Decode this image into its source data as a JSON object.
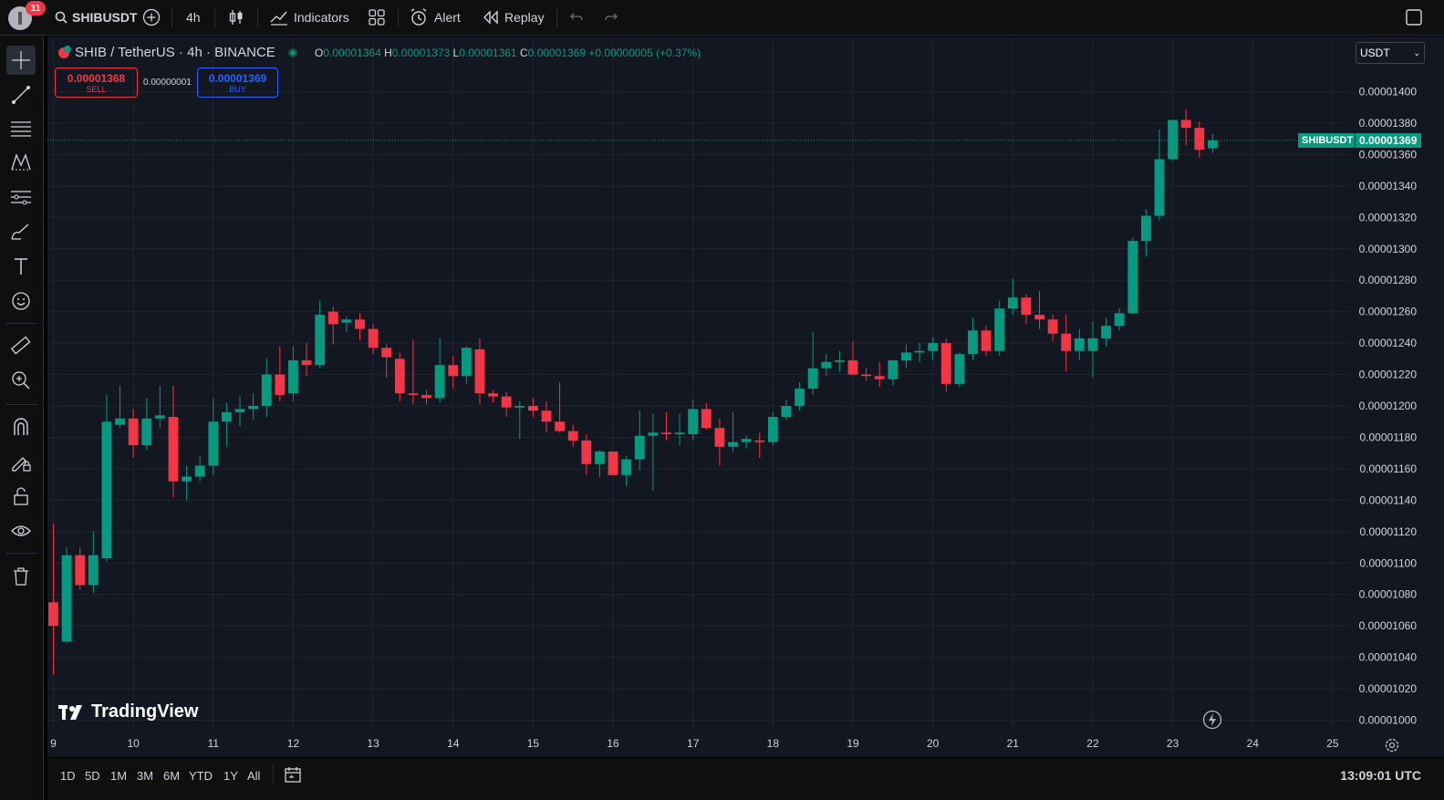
{
  "topbar": {
    "notification_count": "11",
    "symbol": "SHIBUSDT",
    "interval": "4h",
    "indicators_label": "Indicators",
    "alert_label": "Alert",
    "replay_label": "Replay"
  },
  "legend": {
    "title": "SHIB / TetherUS · 4h · BINANCE",
    "open_label": "O",
    "open": "0.00001364",
    "high_label": "H",
    "high": "0.00001373",
    "low_label": "L",
    "low": "0.00001361",
    "close_label": "C",
    "close": "0.00001369",
    "change": "+0.00000005 (+0.37%)"
  },
  "trade": {
    "sell_price": "0.00001368",
    "sell_label": "SELL",
    "spread": "0.00000001",
    "buy_price": "0.00001369",
    "buy_label": "BUY"
  },
  "currency_select": "USDT",
  "price_tag": {
    "symbol": "SHIBUSDT",
    "price": "0.00001369"
  },
  "watermark": "TradingView",
  "bottombar": {
    "ranges": [
      "1D",
      "5D",
      "1M",
      "3M",
      "6M",
      "YTD",
      "1Y",
      "All"
    ],
    "clock": "13:09:01 UTC"
  },
  "colors": {
    "up": "#089981",
    "down": "#f23645",
    "background": "#131722",
    "grid": "#1f2330"
  },
  "icons": {
    "topbar": [
      "avatar-icon",
      "search-icon",
      "add-symbol-icon",
      "candles-icon",
      "indicators-icon",
      "layouts-icon",
      "alert-icon",
      "replay-icon",
      "undo-icon",
      "redo-icon",
      "fullscreen-icon"
    ],
    "leftbar": [
      "crosshair-icon",
      "trendline-icon",
      "fib-icon",
      "pattern-icon",
      "forecast-icon",
      "brush-icon",
      "text-icon",
      "emoji-icon",
      "ruler-icon",
      "zoom-in-icon",
      "magnet-icon",
      "lock-draw-icon",
      "lock-icon",
      "eye-icon",
      "trash-icon"
    ]
  },
  "chart_data": {
    "type": "candlestick",
    "symbol": "SHIBUSDT",
    "interval": "4h",
    "ylim": [
      1e-05,
      1.41e-05
    ],
    "y_ticks": [
      "0.00001400",
      "0.00001380",
      "0.00001360",
      "0.00001340",
      "0.00001320",
      "0.00001300",
      "0.00001280",
      "0.00001260",
      "0.00001240",
      "0.00001220",
      "0.00001200",
      "0.00001180",
      "0.00001160",
      "0.00001140",
      "0.00001120",
      "0.00001100",
      "0.00001080",
      "0.00001060",
      "0.00001040",
      "0.00001020",
      "0.00001000"
    ],
    "x_ticks": [
      "9",
      "10",
      "11",
      "12",
      "13",
      "14",
      "15",
      "16",
      "17",
      "18",
      "19",
      "20",
      "21",
      "22",
      "23",
      "24",
      "25"
    ],
    "last_price": 1.369e-05,
    "candles": [
      {
        "o": 1.075e-05,
        "h": 1.125e-05,
        "l": 1.029e-05,
        "c": 1.06e-05
      },
      {
        "o": 1.05e-05,
        "h": 1.11e-05,
        "l": 1.049e-05,
        "c": 1.105e-05
      },
      {
        "o": 1.105e-05,
        "h": 1.11e-05,
        "l": 1.083e-05,
        "c": 1.086e-05
      },
      {
        "o": 1.086e-05,
        "h": 1.12e-05,
        "l": 1.081e-05,
        "c": 1.105e-05
      },
      {
        "o": 1.103e-05,
        "h": 1.207e-05,
        "l": 1.101e-05,
        "c": 1.19e-05
      },
      {
        "o": 1.188e-05,
        "h": 1.213e-05,
        "l": 1.186e-05,
        "c": 1.192e-05
      },
      {
        "o": 1.192e-05,
        "h": 1.198e-05,
        "l": 1.167e-05,
        "c": 1.175e-05
      },
      {
        "o": 1.175e-05,
        "h": 1.205e-05,
        "l": 1.172e-05,
        "c": 1.192e-05
      },
      {
        "o": 1.192e-05,
        "h": 1.213e-05,
        "l": 1.186e-05,
        "c": 1.194e-05
      },
      {
        "o": 1.193e-05,
        "h": 1.213e-05,
        "l": 1.142e-05,
        "c": 1.152e-05
      },
      {
        "o": 1.152e-05,
        "h": 1.162e-05,
        "l": 1.14e-05,
        "c": 1.155e-05
      },
      {
        "o": 1.155e-05,
        "h": 1.168e-05,
        "l": 1.152e-05,
        "c": 1.162e-05
      },
      {
        "o": 1.162e-05,
        "h": 1.205e-05,
        "l": 1.156e-05,
        "c": 1.19e-05
      },
      {
        "o": 1.19e-05,
        "h": 1.202e-05,
        "l": 1.174e-05,
        "c": 1.196e-05
      },
      {
        "o": 1.196e-05,
        "h": 1.206e-05,
        "l": 1.187e-05,
        "c": 1.198e-05
      },
      {
        "o": 1.198e-05,
        "h": 1.208e-05,
        "l": 1.191e-05,
        "c": 1.2e-05
      },
      {
        "o": 1.2e-05,
        "h": 1.23e-05,
        "l": 1.193e-05,
        "c": 1.22e-05
      },
      {
        "o": 1.22e-05,
        "h": 1.238e-05,
        "l": 1.203e-05,
        "c": 1.207e-05
      },
      {
        "o": 1.208e-05,
        "h": 1.238e-05,
        "l": 1.203e-05,
        "c": 1.229e-05
      },
      {
        "o": 1.229e-05,
        "h": 1.24e-05,
        "l": 1.219e-05,
        "c": 1.226e-05
      },
      {
        "o": 1.226e-05,
        "h": 1.267e-05,
        "l": 1.224e-05,
        "c": 1.258e-05
      },
      {
        "o": 1.26e-05,
        "h": 1.263e-05,
        "l": 1.239e-05,
        "c": 1.252e-05
      },
      {
        "o": 1.253e-05,
        "h": 1.257e-05,
        "l": 1.247e-05,
        "c": 1.255e-05
      },
      {
        "o": 1.255e-05,
        "h": 1.259e-05,
        "l": 1.242e-05,
        "c": 1.249e-05
      },
      {
        "o": 1.249e-05,
        "h": 1.252e-05,
        "l": 1.233e-05,
        "c": 1.237e-05
      },
      {
        "o": 1.237e-05,
        "h": 1.239e-05,
        "l": 1.218e-05,
        "c": 1.231e-05
      },
      {
        "o": 1.23e-05,
        "h": 1.234e-05,
        "l": 1.203e-05,
        "c": 1.208e-05
      },
      {
        "o": 1.208e-05,
        "h": 1.242e-05,
        "l": 1.201e-05,
        "c": 1.207e-05
      },
      {
        "o": 1.207e-05,
        "h": 1.21e-05,
        "l": 1.201e-05,
        "c": 1.205e-05
      },
      {
        "o": 1.205e-05,
        "h": 1.243e-05,
        "l": 1.202e-05,
        "c": 1.226e-05
      },
      {
        "o": 1.226e-05,
        "h": 1.232e-05,
        "l": 1.211e-05,
        "c": 1.219e-05
      },
      {
        "o": 1.219e-05,
        "h": 1.238e-05,
        "l": 1.214e-05,
        "c": 1.237e-05
      },
      {
        "o": 1.236e-05,
        "h": 1.243e-05,
        "l": 1.201e-05,
        "c": 1.208e-05
      },
      {
        "o": 1.208e-05,
        "h": 1.21e-05,
        "l": 1.202e-05,
        "c": 1.206e-05
      },
      {
        "o": 1.206e-05,
        "h": 1.209e-05,
        "l": 1.193e-05,
        "c": 1.199e-05
      },
      {
        "o": 1.199e-05,
        "h": 1.203e-05,
        "l": 1.179e-05,
        "c": 1.2e-05
      },
      {
        "o": 1.2e-05,
        "h": 1.205e-05,
        "l": 1.193e-05,
        "c": 1.197e-05
      },
      {
        "o": 1.197e-05,
        "h": 1.203e-05,
        "l": 1.183e-05,
        "c": 1.19e-05
      },
      {
        "o": 1.19e-05,
        "h": 1.215e-05,
        "l": 1.183e-05,
        "c": 1.184e-05
      },
      {
        "o": 1.184e-05,
        "h": 1.188e-05,
        "l": 1.174e-05,
        "c": 1.178e-05
      },
      {
        "o": 1.178e-05,
        "h": 1.182e-05,
        "l": 1.156e-05,
        "c": 1.163e-05
      },
      {
        "o": 1.163e-05,
        "h": 1.172e-05,
        "l": 1.155e-05,
        "c": 1.171e-05
      },
      {
        "o": 1.171e-05,
        "h": 1.171e-05,
        "l": 1.158e-05,
        "c": 1.156e-05
      },
      {
        "o": 1.156e-05,
        "h": 1.168e-05,
        "l": 1.149e-05,
        "c": 1.166e-05
      },
      {
        "o": 1.166e-05,
        "h": 1.197e-05,
        "l": 1.159e-05,
        "c": 1.181e-05
      },
      {
        "o": 1.181e-05,
        "h": 1.195e-05,
        "l": 1.146e-05,
        "c": 1.183e-05
      },
      {
        "o": 1.183e-05,
        "h": 1.196e-05,
        "l": 1.178e-05,
        "c": 1.182e-05
      },
      {
        "o": 1.182e-05,
        "h": 1.195e-05,
        "l": 1.175e-05,
        "c": 1.183e-05
      },
      {
        "o": 1.182e-05,
        "h": 1.204e-05,
        "l": 1.178e-05,
        "c": 1.198e-05
      },
      {
        "o": 1.198e-05,
        "h": 1.202e-05,
        "l": 1.185e-05,
        "c": 1.186e-05
      },
      {
        "o": 1.186e-05,
        "h": 1.192e-05,
        "l": 1.162e-05,
        "c": 1.174e-05
      },
      {
        "o": 1.174e-05,
        "h": 1.196e-05,
        "l": 1.171e-05,
        "c": 1.177e-05
      },
      {
        "o": 1.177e-05,
        "h": 1.181e-05,
        "l": 1.173e-05,
        "c": 1.179e-05
      },
      {
        "o": 1.178e-05,
        "h": 1.183e-05,
        "l": 1.167e-05,
        "c": 1.177e-05
      },
      {
        "o": 1.177e-05,
        "h": 1.196e-05,
        "l": 1.175e-05,
        "c": 1.193e-05
      },
      {
        "o": 1.193e-05,
        "h": 1.204e-05,
        "l": 1.191e-05,
        "c": 1.2e-05
      },
      {
        "o": 1.2e-05,
        "h": 1.215e-05,
        "l": 1.197e-05,
        "c": 1.211e-05
      },
      {
        "o": 1.211e-05,
        "h": 1.247e-05,
        "l": 1.207e-05,
        "c": 1.224e-05
      },
      {
        "o": 1.224e-05,
        "h": 1.233e-05,
        "l": 1.219e-05,
        "c": 1.228e-05
      },
      {
        "o": 1.228e-05,
        "h": 1.235e-05,
        "l": 1.222e-05,
        "c": 1.229e-05
      },
      {
        "o": 1.229e-05,
        "h": 1.241e-05,
        "l": 1.221e-05,
        "c": 1.22e-05
      },
      {
        "o": 1.22e-05,
        "h": 1.224e-05,
        "l": 1.216e-05,
        "c": 1.219e-05
      },
      {
        "o": 1.219e-05,
        "h": 1.228e-05,
        "l": 1.212e-05,
        "c": 1.217e-05
      },
      {
        "o": 1.217e-05,
        "h": 1.229e-05,
        "l": 1.213e-05,
        "c": 1.229e-05
      },
      {
        "o": 1.229e-05,
        "h": 1.239e-05,
        "l": 1.224e-05,
        "c": 1.234e-05
      },
      {
        "o": 1.234e-05,
        "h": 1.24e-05,
        "l": 1.228e-05,
        "c": 1.235e-05
      },
      {
        "o": 1.235e-05,
        "h": 1.244e-05,
        "l": 1.229e-05,
        "c": 1.24e-05
      },
      {
        "o": 1.24e-05,
        "h": 1.243e-05,
        "l": 1.209e-05,
        "c": 1.214e-05
      },
      {
        "o": 1.214e-05,
        "h": 1.234e-05,
        "l": 1.212e-05,
        "c": 1.233e-05
      },
      {
        "o": 1.233e-05,
        "h": 1.256e-05,
        "l": 1.229e-05,
        "c": 1.248e-05
      },
      {
        "o": 1.248e-05,
        "h": 1.251e-05,
        "l": 1.232e-05,
        "c": 1.235e-05
      },
      {
        "o": 1.235e-05,
        "h": 1.267e-05,
        "l": 1.232e-05,
        "c": 1.262e-05
      },
      {
        "o": 1.262e-05,
        "h": 1.281e-05,
        "l": 1.258e-05,
        "c": 1.269e-05
      },
      {
        "o": 1.269e-05,
        "h": 1.271e-05,
        "l": 1.252e-05,
        "c": 1.258e-05
      },
      {
        "o": 1.258e-05,
        "h": 1.273e-05,
        "l": 1.249e-05,
        "c": 1.255e-05
      },
      {
        "o": 1.255e-05,
        "h": 1.258e-05,
        "l": 1.241e-05,
        "c": 1.246e-05
      },
      {
        "o": 1.246e-05,
        "h": 1.258e-05,
        "l": 1.222e-05,
        "c": 1.235e-05
      },
      {
        "o": 1.235e-05,
        "h": 1.249e-05,
        "l": 1.229e-05,
        "c": 1.243e-05
      },
      {
        "o": 1.235e-05,
        "h": 1.254e-05,
        "l": 1.218e-05,
        "c": 1.243e-05
      },
      {
        "o": 1.243e-05,
        "h": 1.256e-05,
        "l": 1.238e-05,
        "c": 1.251e-05
      },
      {
        "o": 1.251e-05,
        "h": 1.262e-05,
        "l": 1.248e-05,
        "c": 1.259e-05
      },
      {
        "o": 1.259e-05,
        "h": 1.307e-05,
        "l": 1.258e-05,
        "c": 1.305e-05
      },
      {
        "o": 1.305e-05,
        "h": 1.325e-05,
        "l": 1.295e-05,
        "c": 1.321e-05
      },
      {
        "o": 1.321e-05,
        "h": 1.376e-05,
        "l": 1.318e-05,
        "c": 1.357e-05
      },
      {
        "o": 1.357e-05,
        "h": 1.382e-05,
        "l": 1.356e-05,
        "c": 1.382e-05
      },
      {
        "o": 1.382e-05,
        "h": 1.389e-05,
        "l": 1.366e-05,
        "c": 1.377e-05
      },
      {
        "o": 1.377e-05,
        "h": 1.381e-05,
        "l": 1.358e-05,
        "c": 1.363e-05
      },
      {
        "o": 1.364e-05,
        "h": 1.373e-05,
        "l": 1.361e-05,
        "c": 1.369e-05
      }
    ]
  }
}
